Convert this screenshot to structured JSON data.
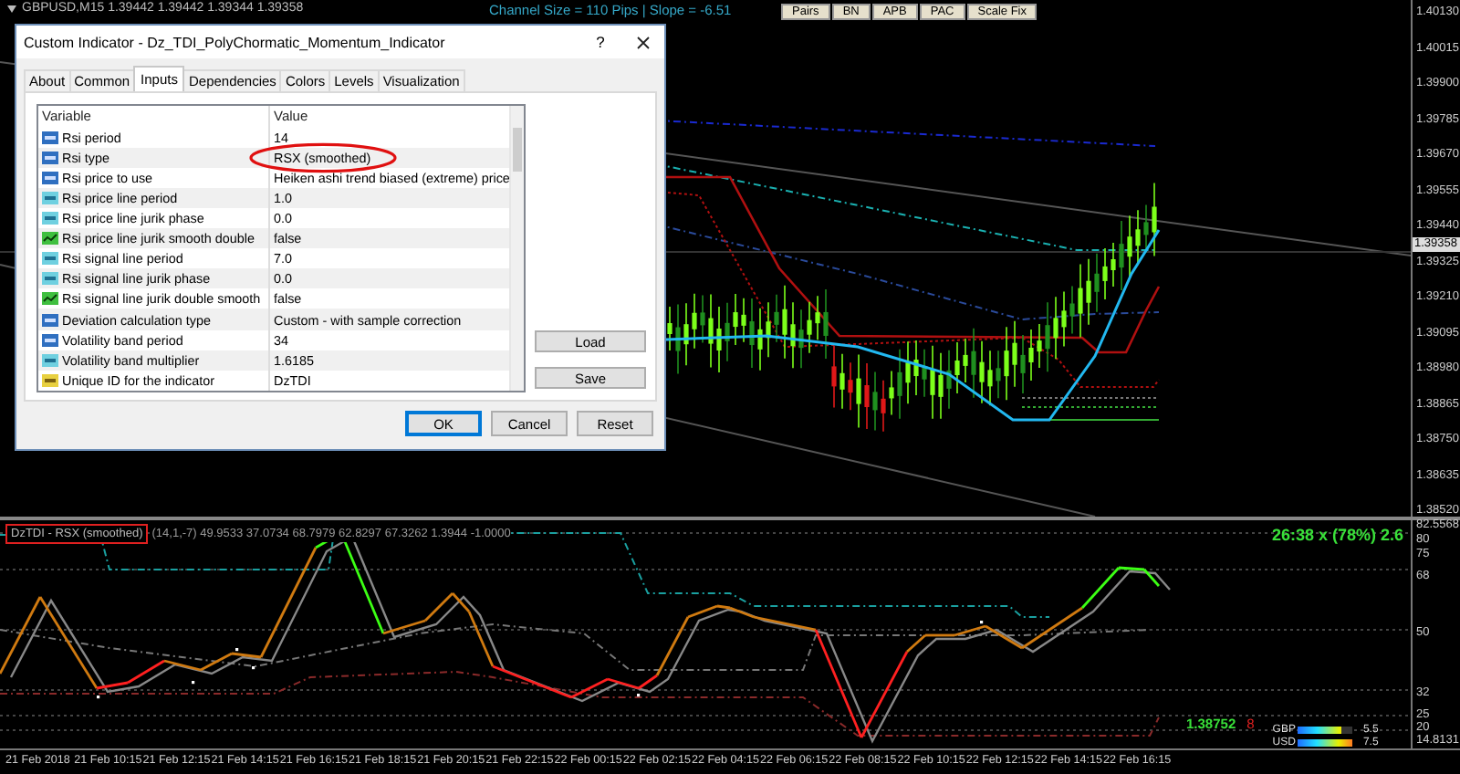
{
  "chart_header": {
    "symbol_line": "GBPUSD,M15 1.39442 1.39442 1.39344 1.39358",
    "channel_info": "Channel Size = 110 Pips | Slope = -6.51"
  },
  "toolbar_buttons": [
    "Pairs",
    "BN",
    "APB",
    "PAC",
    "Scale Fix"
  ],
  "price_axis": {
    "labels": [
      "1.40130",
      "1.40015",
      "1.39900",
      "1.39785",
      "1.39670",
      "1.39555",
      "1.39440",
      "1.39325",
      "1.39210",
      "1.39095",
      "1.38980",
      "1.38865",
      "1.38750",
      "1.38635",
      "1.38520"
    ],
    "current_price": "1.39358"
  },
  "dialog": {
    "title": "Custom Indicator - Dz_TDI_PolyChormatic_Momentum_Indicator",
    "help": "?",
    "tabs": [
      {
        "label": "About",
        "selected": false
      },
      {
        "label": "Common",
        "selected": false
      },
      {
        "label": "Inputs",
        "selected": true
      },
      {
        "label": "Dependencies",
        "selected": false
      },
      {
        "label": "Colors",
        "selected": false
      },
      {
        "label": "Levels",
        "selected": false
      },
      {
        "label": "Visualization",
        "selected": false
      }
    ],
    "columns": [
      "Variable",
      "Value"
    ],
    "rows": [
      {
        "kind": "int",
        "variable": "Rsi period",
        "value": "14",
        "circled": false
      },
      {
        "kind": "int",
        "variable": "Rsi type",
        "value": "RSX (smoothed)",
        "circled": true
      },
      {
        "kind": "int",
        "variable": "Rsi price to use",
        "value": "Heiken ashi trend biased (extreme) price",
        "circled": false
      },
      {
        "kind": "double",
        "variable": "Rsi price line period",
        "value": "1.0",
        "circled": false
      },
      {
        "kind": "double",
        "variable": "Rsi price line jurik phase",
        "value": "0.0",
        "circled": false
      },
      {
        "kind": "bool",
        "variable": "Rsi price line jurik smooth double",
        "value": "false",
        "circled": false
      },
      {
        "kind": "double",
        "variable": "Rsi signal line period",
        "value": "7.0",
        "circled": false
      },
      {
        "kind": "double",
        "variable": "Rsi signal line jurik phase",
        "value": "0.0",
        "circled": false
      },
      {
        "kind": "bool",
        "variable": "Rsi signal line jurik double smooth",
        "value": "false",
        "circled": false
      },
      {
        "kind": "int",
        "variable": "Deviation calculation type",
        "value": "Custom - with sample correction",
        "circled": false
      },
      {
        "kind": "int",
        "variable": "Volatility band period",
        "value": "34",
        "circled": false
      },
      {
        "kind": "double",
        "variable": "Volatility band multiplier",
        "value": "1.6185",
        "circled": false
      },
      {
        "kind": "string",
        "variable": "Unique ID for the indicator",
        "value": "DzTDI",
        "circled": false
      }
    ],
    "side_buttons": [
      "Load",
      "Save"
    ],
    "buttons": [
      {
        "label": "OK",
        "default": true
      },
      {
        "label": "Cancel",
        "default": false
      },
      {
        "label": "Reset",
        "default": false
      }
    ]
  },
  "indicator": {
    "name": "DzTDI - RSX (smoothed)",
    "values": "(14,1,-7) 49.9533 37.0734 68.7979 62.8297 67.3262 1.3944 -1.0000",
    "timer": "26:38 x (78%) 2.6",
    "price": "1.38752",
    "count": "8",
    "axis_labels": [
      "82.5568",
      "80",
      "75",
      "68",
      "50",
      "32",
      "25",
      "20",
      "14.8131"
    ],
    "strength": [
      {
        "currency": "GBP",
        "level": 0.78,
        "reading": "5.5"
      },
      {
        "currency": "USD",
        "level": 1.0,
        "reading": "7.5"
      }
    ]
  },
  "time_axis": [
    "21 Feb 2018",
    "21 Feb 10:15",
    "21 Feb 12:15",
    "21 Feb 14:15",
    "21 Feb 16:15",
    "21 Feb 18:15",
    "21 Feb 20:15",
    "21 Feb 22:15",
    "22 Feb 00:15",
    "22 Feb 02:15",
    "22 Feb 04:15",
    "22 Feb 06:15",
    "22 Feb 08:15",
    "22 Feb 10:15",
    "22 Feb 12:15",
    "22 Feb 14:15",
    "22 Feb 16:15"
  ]
}
